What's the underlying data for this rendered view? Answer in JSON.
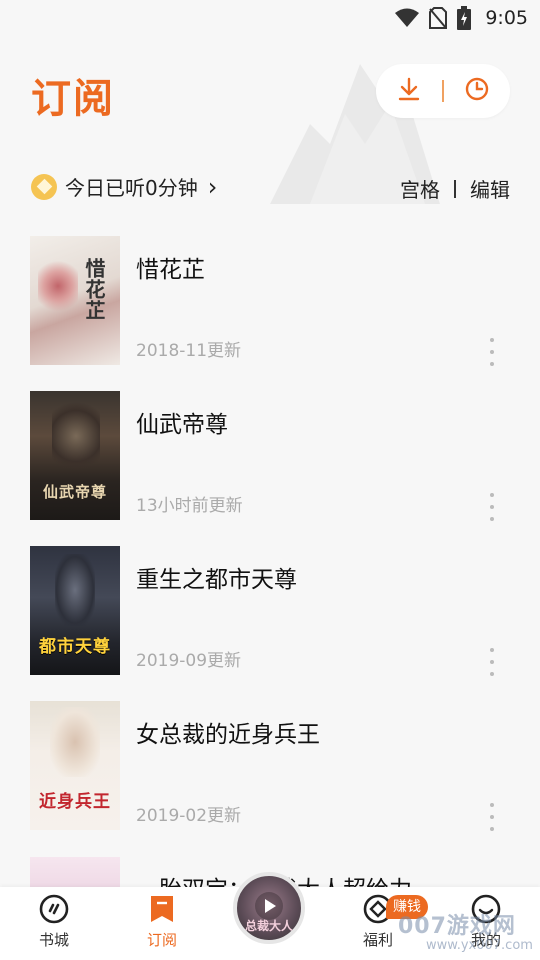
{
  "status_bar": {
    "time": "9:05",
    "icons": [
      "wifi-icon",
      "no-sim-icon",
      "battery-charging-icon"
    ]
  },
  "header": {
    "title": "订阅",
    "actions": [
      {
        "icon": "download-icon"
      },
      {
        "icon": "history-clock-icon"
      }
    ]
  },
  "listen": {
    "icon": "coin-icon",
    "text": "今日已听0分钟",
    "chevron": "›"
  },
  "view_options": {
    "grid": "宫格",
    "edit": "编辑"
  },
  "books": [
    {
      "title": "惜花芷",
      "updated": "2018-11更新",
      "cover_text": "惜花芷",
      "cover_color": "#e9e3dc"
    },
    {
      "title": "仙武帝尊",
      "updated": "13小时前更新",
      "cover_text": "仙武帝尊",
      "cover_color": "#2b2521"
    },
    {
      "title": "重生之都市天尊",
      "updated": "2019-09更新",
      "cover_text": "都市天尊",
      "cover_color": "#1f2128"
    },
    {
      "title": "女总裁的近身兵王",
      "updated": "2019-02更新",
      "cover_text": "近身兵王",
      "cover_color": "#efe8e2"
    }
  ],
  "peek_book": {
    "title": "一胎双宝：总裁大人超给力"
  },
  "bottom_nav": {
    "items": [
      {
        "label": "书城",
        "icon": "bookstore-icon"
      },
      {
        "label": "订阅",
        "icon": "bookmark-icon",
        "active": true
      },
      {
        "label": "福利",
        "icon": "welfare-icon"
      },
      {
        "label": "我的",
        "icon": "profile-icon"
      }
    ],
    "earn_badge": "赚钱",
    "player": {
      "icon": "play-icon",
      "disc_text": "总裁大人"
    }
  },
  "watermark": {
    "text": "007游戏网",
    "url": "www.yx007.com"
  },
  "colors": {
    "accent": "#ec6a21",
    "background": "#f7f7f7"
  }
}
